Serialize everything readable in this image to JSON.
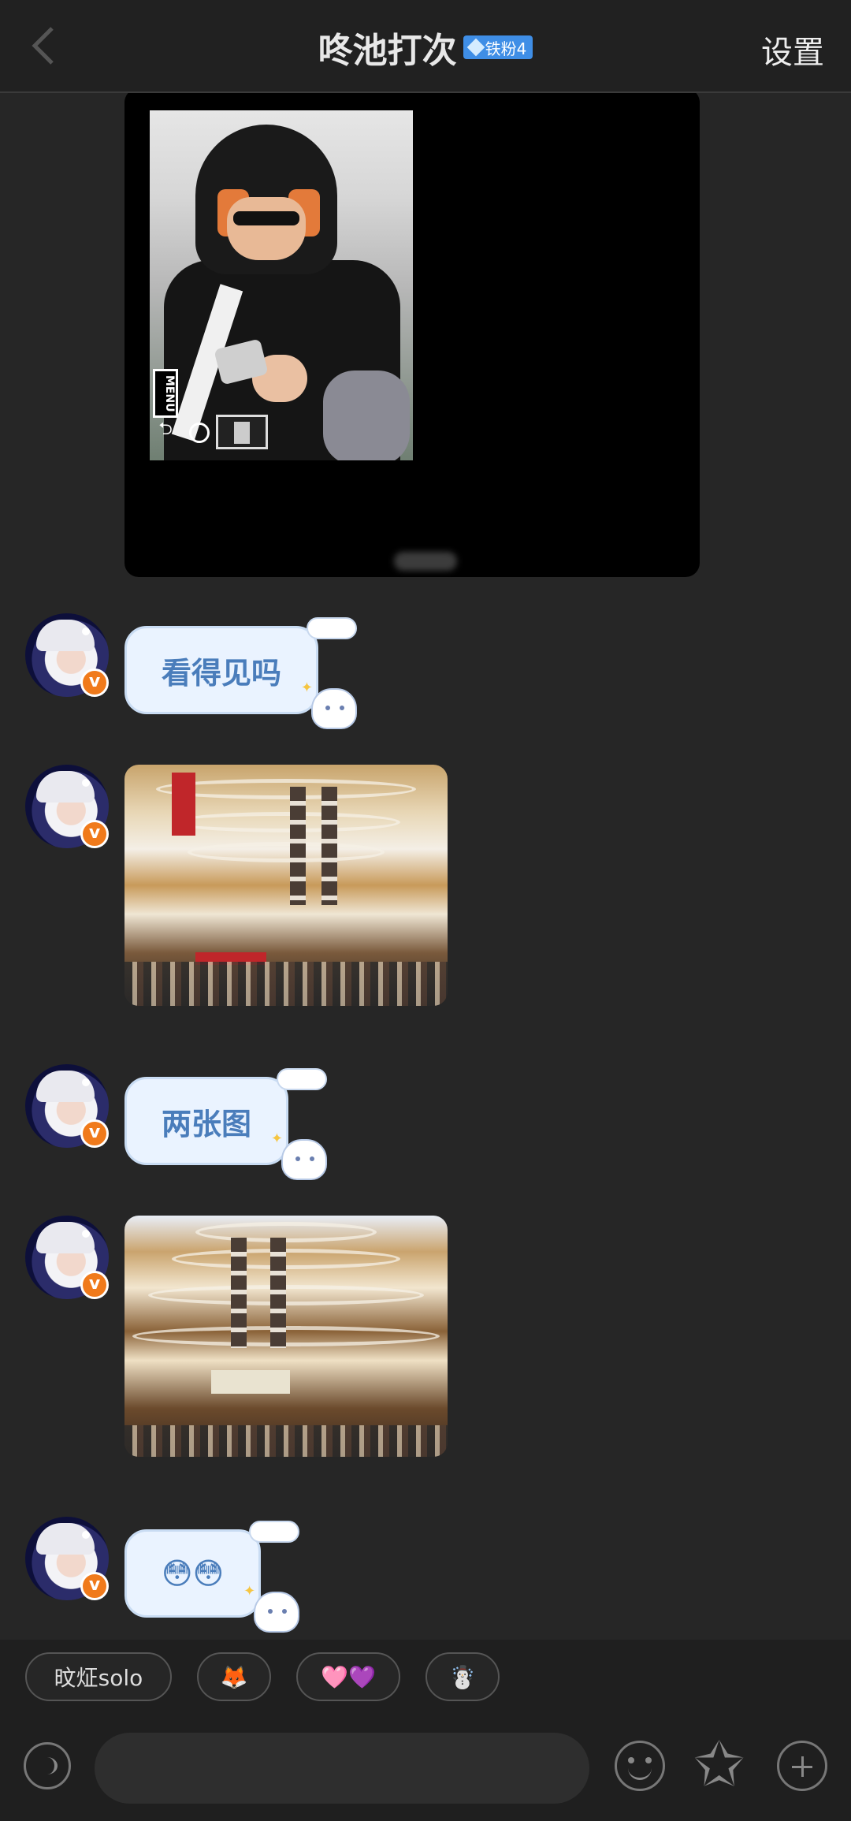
{
  "header": {
    "title": "咚池打次",
    "badge": "铁粉4",
    "settings_label": "设置"
  },
  "messages": [
    {
      "type": "text",
      "text": "看得见吗"
    },
    {
      "type": "image",
      "desc": "mall atrium with hanging banners"
    },
    {
      "type": "text",
      "text": "两张图"
    },
    {
      "type": "image",
      "desc": "mall atrium view from below"
    },
    {
      "type": "text",
      "text": "😳😳"
    }
  ],
  "top_image": {
    "menu_label": "MENU"
  },
  "quick_replies": [
    "旼炡solo",
    "🦊",
    "🩷💜",
    "☃️"
  ],
  "icons": {
    "back": "chevron-left-icon",
    "voice": "voice-icon",
    "emoji": "emoji-icon",
    "sticker": "sticker-star-icon",
    "plus": "plus-icon"
  }
}
